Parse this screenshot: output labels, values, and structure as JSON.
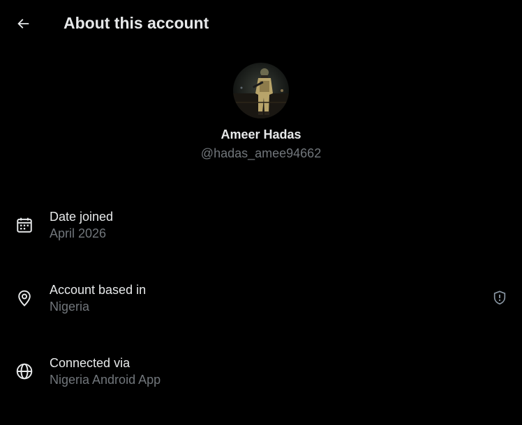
{
  "header": {
    "title": "About this account",
    "back_icon": "arrow-left-icon"
  },
  "profile": {
    "display_name": "Ameer Hadas",
    "handle": "@hadas_amee94662",
    "avatar_alt": "profile photo"
  },
  "rows": [
    {
      "icon": "calendar-icon",
      "label": "Date joined",
      "value": "April 2026"
    },
    {
      "icon": "location-pin-icon",
      "label": "Account based in",
      "value": "Nigeria",
      "trailing_icon": "shield-alert-icon"
    },
    {
      "icon": "globe-icon",
      "label": "Connected via",
      "value": "Nigeria Android App"
    }
  ],
  "colors": {
    "background": "#000000",
    "primary_text": "#e7e9ea",
    "secondary_text": "#71767b",
    "icon": "#e7e9ea",
    "muted_icon": "#8b98a5"
  }
}
